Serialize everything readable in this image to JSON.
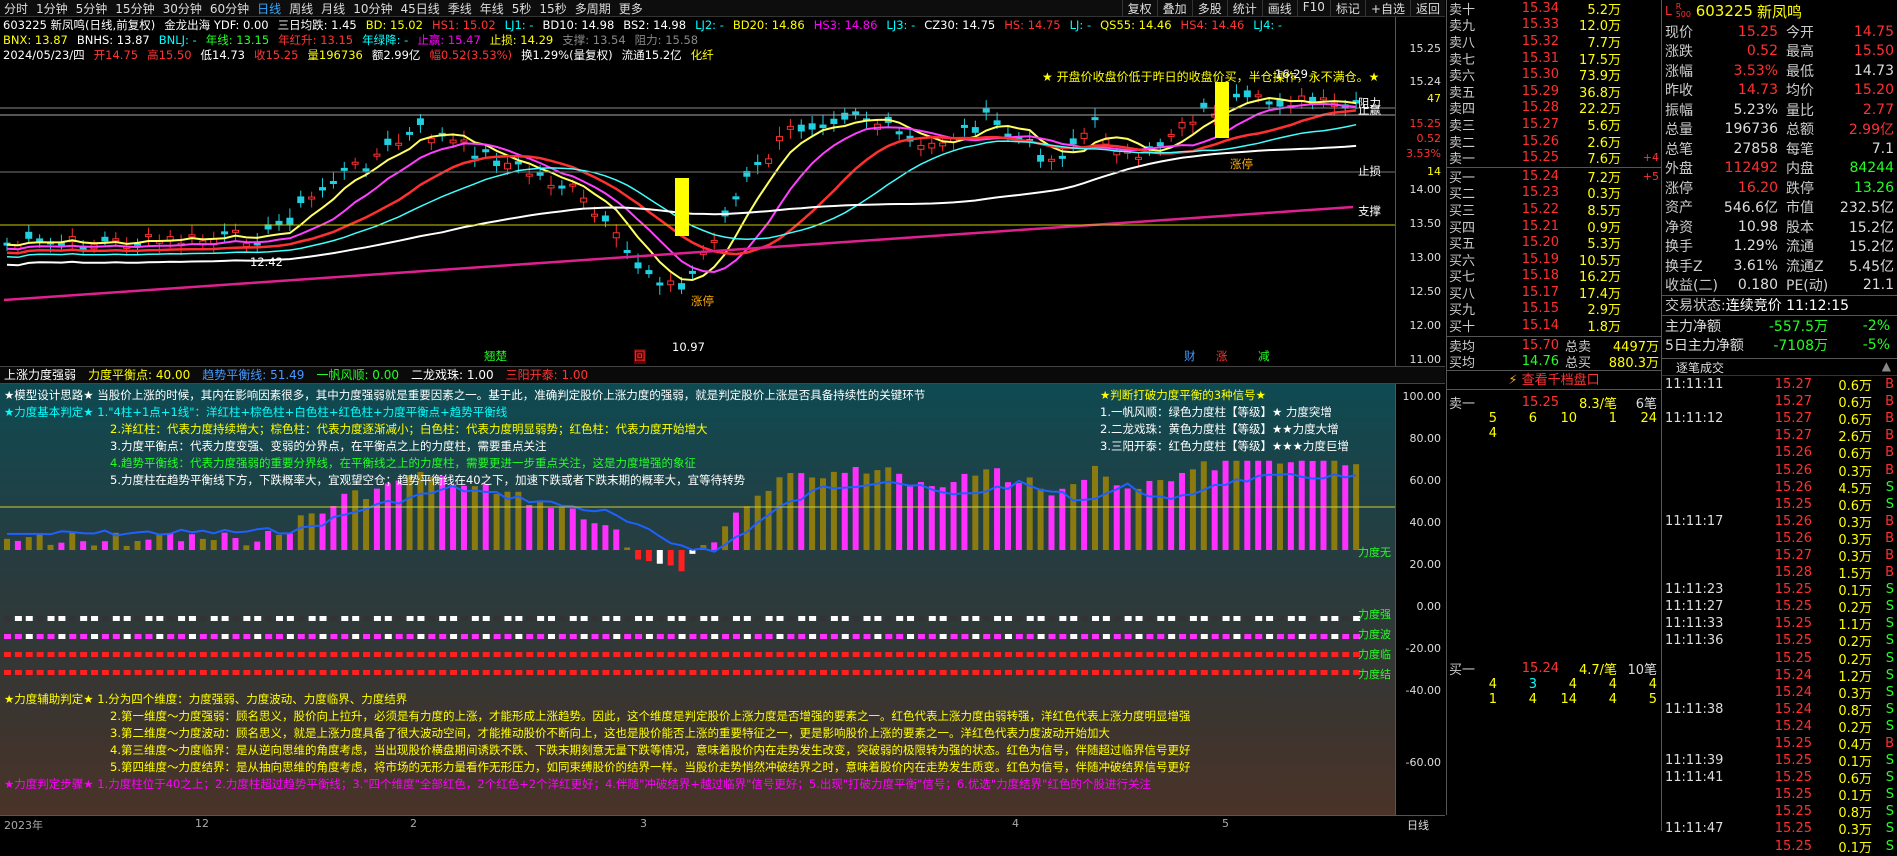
{
  "periods": [
    "分时",
    "1分钟",
    "5分钟",
    "15分钟",
    "30分钟",
    "60分钟",
    "日线",
    "周线",
    "月线",
    "10分钟",
    "45日线",
    "季线",
    "年线",
    "5秒",
    "15秒",
    "多周期",
    "更多"
  ],
  "active_period": "日线",
  "toolbar": [
    "复权",
    "叠加",
    "多股",
    "统计",
    "画线",
    "F10",
    "标记",
    "+自选",
    "返回"
  ],
  "header": {
    "l1": [
      {
        "t": "603225 新凤鸣(日线,前复权)",
        "c": "wht"
      },
      {
        "t": "金龙出海 YDF: 0.00",
        "c": "wht"
      },
      {
        "t": "三日均跌: 1.45",
        "c": "wht"
      },
      {
        "t": "BD: 15.02",
        "c": "yel"
      },
      {
        "t": "HS1: 15.02",
        "c": "red"
      },
      {
        "t": "LJ1: -",
        "c": "cya"
      },
      {
        "t": "BD10: 14.98",
        "c": "wht"
      },
      {
        "t": "BS2: 14.98",
        "c": "wht"
      },
      {
        "t": "LJ2: -",
        "c": "cya"
      },
      {
        "t": "BD20: 14.86",
        "c": "yel"
      },
      {
        "t": "HS3: 14.86",
        "c": "mag"
      },
      {
        "t": "LJ3: -",
        "c": "cya"
      },
      {
        "t": "CZ30: 14.75",
        "c": "wht"
      },
      {
        "t": "HS: 14.75",
        "c": "red"
      },
      {
        "t": "LJ: -",
        "c": "cya"
      },
      {
        "t": "QS55: 14.46",
        "c": "yel"
      },
      {
        "t": "HS4: 14.46",
        "c": "red"
      },
      {
        "t": "LJ4: -",
        "c": "cya"
      }
    ],
    "l2": [
      {
        "t": "BNX: 13.87",
        "c": "yel"
      },
      {
        "t": "BNHS: 13.87",
        "c": "wht"
      },
      {
        "t": "BNLJ: -",
        "c": "cya"
      },
      {
        "t": "年线: 13.15",
        "c": "grn"
      },
      {
        "t": "年红升: 13.15",
        "c": "red"
      },
      {
        "t": "年绿降: -",
        "c": "cya"
      },
      {
        "t": "止赢: 15.47",
        "c": "mag"
      },
      {
        "t": "止损: 14.29",
        "c": "yel"
      },
      {
        "t": "支撑: 13.54",
        "c": "gry"
      },
      {
        "t": "阻力: 15.58",
        "c": "gry"
      }
    ],
    "l3": [
      {
        "t": "2024/05/23/四",
        "c": "wht"
      },
      {
        "t": "开14.75",
        "c": "red"
      },
      {
        "t": "高15.50",
        "c": "red"
      },
      {
        "t": "低14.73",
        "c": "wht"
      },
      {
        "t": "收15.25",
        "c": "red"
      },
      {
        "t": "量196736",
        "c": "yel"
      },
      {
        "t": "额2.99亿",
        "c": "wht"
      },
      {
        "t": "幅0.52(3.53%)",
        "c": "red"
      },
      {
        "t": "换1.29%(量复权)",
        "c": "wht"
      },
      {
        "t": "流通15.2亿",
        "c": "wht"
      },
      {
        "t": "化纤",
        "c": "yel"
      }
    ]
  },
  "chart_labels": {
    "banner": "★ 开盘价收盘价低于昨日的收盘价买，半仓操作，永不满仓。★",
    "high": "16.29",
    "low": "10.97",
    "zhangting": "涨停",
    "zhangting2": "涨停",
    "zs": "止损",
    "zy": "止赢",
    "zl": "阻力",
    "zc": "支撑",
    "price_mark": "15.25",
    "tag_pct": "3.53%",
    "tag_chg": "0.52",
    "tag_14": "14",
    "tag_47": "47",
    "tag_12": "12.42",
    "cai": "财",
    "zhang": "涨",
    "jian": "减",
    "qiao": "翘楚",
    "hui": "回"
  },
  "axis_main": [
    "15.25",
    "15.24",
    "14.00",
    "13.50",
    "13.00",
    "12.50",
    "12.00",
    "11.50",
    "11.00"
  ],
  "sub_header": [
    {
      "t": "上涨力度强弱",
      "c": "wht"
    },
    {
      "t": "力度平衡点: 40.00",
      "c": "yel"
    },
    {
      "t": "趋势平衡线: 51.49",
      "c": "blu"
    },
    {
      "t": "一帆风顺: 0.00",
      "c": "grn"
    },
    {
      "t": "二龙戏珠: 1.00",
      "c": "wht"
    },
    {
      "t": "三阳开泰: 1.00",
      "c": "red"
    }
  ],
  "axis_sub": [
    "100.00",
    "80.00",
    "60.00",
    "40.00",
    "20.00",
    "0.00",
    "-20.00",
    "-40.00",
    "-60.00"
  ],
  "sub_notes": {
    "n1": "★模型设计思路★ 当股价上涨的时候，其内在影响因素很多，其中力度强弱就是重要因素之一。基于此，准确判定股价上涨力度的强弱，就是判定股价上涨是否具备持续性的关键环节",
    "n2": "★力度基本判定★ 1.\"4柱+1点+1线\"：洋红柱+棕色柱+白色柱+红色柱+力度平衡点+趋势平衡线",
    "n3": "2.洋红柱：代表力度持续增大；棕色柱：代表力度逐渐减小；白色柱：代表力度明显弱势；红色柱：代表力度开始增大",
    "n4": "3.力度平衡点：代表力度变强、变弱的分界点，在平衡点之上的力度柱，需要重点关注",
    "n5": "4.趋势平衡线：代表力度强弱的重要分界线，在平衡线之上的力度柱，需要更进一步重点关注，这是力度增强的象征",
    "n6": "5.力度柱在趋势平衡线下方，下跌概率大，宜观望空仓；趋势平衡线在40之下，加速下跌或者下跌末期的概率大，宜等待转势",
    "r1": "★判断打破力度平衡的3种信号★",
    "r2": "1.一帆风顺：绿色力度柱【等级】★  力度突增",
    "r3": "2.二龙戏珠：黄色力度柱【等级】★★力度大增",
    "r4": "3.三阳开泰：红色力度柱【等级】★★★力度巨增",
    "b1": "★力度辅助判定★ 1.分为四个维度：力度强弱、力度波动、力度临界、力度结界",
    "b2": "2.第一维度～力度强弱：顾名思义，股价向上拉升，必须是有力度的上涨，才能形成上涨趋势。因此，这个维度是判定股价上涨力度是否增强的要素之一。红色代表上涨力度由弱转强，洋红色代表上涨力度明显增强",
    "b3": "3.第二维度～力度波动：顾名思义，就是上涨力度具备了很大波动空间，才能推动股价不断向上，这也是股价能否上涨的重要特征之一，更是影响股价上涨的要素之一。洋红色代表力度波动开始加大",
    "b4": "4.第三维度～力度临界：是从逆向思维的角度考虑，当出现股价横盘期间诱跌不跌、下跌末期刻意无量下跌等情况，意味着股价内在走势发生改变，突破弱的极限转为强的状态。红色为信号，伴随超过临界信号更好",
    "b5": "5.第四维度～力度结界：是从抽向思维的角度考虑，将市场的无形力量看作无形压力，如同束缚股价的结界一样。当股价走势悄然冲破结界之时，意味着股价内在走势发生质变。红色为信号，伴随冲破结界信号更好",
    "b6": "★力度判定步骤★ 1.力度柱位于40之上；2.力度柱超过趋势平衡线；3.\"四个维度\"全部红色，2个红色+2个洋红更好；4.伴随\"冲破结界+越过临界\"信号更好；5.出现\"打破力度平衡\"信号；6.优选\"力度结界\"红色的个股进行关注",
    "side1": "力度无",
    "side2": "力度强",
    "side3": "力度波",
    "side4": "力度临",
    "side5": "力度结"
  },
  "dates": [
    "2023年",
    "12",
    "2",
    "3",
    "4",
    "5",
    "日线"
  ],
  "orderbook": {
    "asks": [
      [
        "卖十",
        "15.34",
        "5.2万",
        ""
      ],
      [
        "卖九",
        "15.33",
        "12.0万",
        ""
      ],
      [
        "卖八",
        "15.32",
        "7.7万",
        ""
      ],
      [
        "卖七",
        "15.31",
        "17.5万",
        ""
      ],
      [
        "卖六",
        "15.30",
        "73.9万",
        ""
      ],
      [
        "卖五",
        "15.29",
        "36.8万",
        ""
      ],
      [
        "卖四",
        "15.28",
        "22.2万",
        ""
      ],
      [
        "卖三",
        "15.27",
        "5.6万",
        ""
      ],
      [
        "卖二",
        "15.26",
        "2.6万",
        ""
      ],
      [
        "卖一",
        "15.25",
        "7.6万",
        "+4"
      ]
    ],
    "bids": [
      [
        "买一",
        "15.24",
        "7.2万",
        "+5"
      ],
      [
        "买二",
        "15.23",
        "0.3万",
        ""
      ],
      [
        "买三",
        "15.22",
        "8.5万",
        ""
      ],
      [
        "买四",
        "15.21",
        "0.9万",
        ""
      ],
      [
        "买五",
        "15.20",
        "5.3万",
        ""
      ],
      [
        "买六",
        "15.19",
        "10.5万",
        ""
      ],
      [
        "买七",
        "15.18",
        "16.2万",
        ""
      ],
      [
        "买八",
        "15.17",
        "17.4万",
        ""
      ],
      [
        "买九",
        "15.15",
        "2.9万",
        ""
      ],
      [
        "买十",
        "15.14",
        "1.8万",
        ""
      ]
    ],
    "avg_ask_label": "卖均",
    "avg_ask": "15.70",
    "total_ask_label": "总卖",
    "total_ask": "4497万",
    "avg_bid_label": "买均",
    "avg_bid": "14.76",
    "total_bid_label": "总买",
    "total_bid": "880.3万",
    "more": "查看千档盘口",
    "q1_label": "卖一",
    "q1_price": "15.25",
    "q1_info": "8.3/笔",
    "q1_count": "6笔",
    "q1_nums": [
      "5",
      "6",
      "10",
      "1",
      "24",
      "4"
    ],
    "q2_label": "买一",
    "q2_price": "15.24",
    "q2_info": "4.7/笔",
    "q2_count": "10笔",
    "q2_nums": [
      "4",
      "3",
      "4",
      "4",
      "4",
      "1",
      "4",
      "14",
      "4",
      "5"
    ]
  },
  "stock": {
    "code": "603225",
    "name": "新凤鸣",
    "flag": "L",
    "badge": "R 500"
  },
  "info": [
    [
      "现价",
      "15.25",
      "今开",
      "14.75"
    ],
    [
      "涨跌",
      "0.52",
      "最高",
      "15.50"
    ],
    [
      "涨幅",
      "3.53%",
      "最低",
      "14.73"
    ],
    [
      "昨收",
      "14.73",
      "均价",
      "15.20"
    ],
    [
      "振幅",
      "5.23%",
      "量比",
      "2.77"
    ],
    [
      "总量",
      "196736",
      "总额",
      "2.99亿"
    ],
    [
      "总笔",
      "27858",
      "每笔",
      "7.1"
    ],
    [
      "外盘",
      "112492",
      "内盘",
      "84244"
    ],
    [
      "涨停",
      "16.20",
      "跌停",
      "13.26"
    ],
    [
      "资产",
      "546.6亿",
      "市值",
      "232.5亿"
    ],
    [
      "净资",
      "10.98",
      "股本",
      "15.2亿"
    ],
    [
      "换手",
      "1.29%",
      "流通",
      "15.2亿"
    ],
    [
      "换手Z",
      "3.61%",
      "流通Z",
      "5.45亿"
    ],
    [
      "收益(二)",
      "0.180",
      "PE(动)",
      "21.1"
    ]
  ],
  "status": {
    "label": "交易状态:",
    "value": "连续竞价 11:12:15"
  },
  "netflow": [
    {
      "k": "主力净额",
      "v": "-557.5万",
      "p": "-2%"
    },
    {
      "k": "5日主力净额",
      "v": "-7108万",
      "p": "-5%"
    }
  ],
  "trades_title": "逐笔成交",
  "trades": [
    [
      "11:11:11",
      "15.27",
      "0.6万",
      "B"
    ],
    [
      "",
      "15.27",
      "0.6万",
      "B"
    ],
    [
      "11:11:12",
      "15.27",
      "0.6万",
      "B"
    ],
    [
      "",
      "15.27",
      "2.6万",
      "B"
    ],
    [
      "",
      "15.26",
      "0.6万",
      "B"
    ],
    [
      "",
      "15.26",
      "0.3万",
      "B"
    ],
    [
      "",
      "15.26",
      "4.5万",
      "S"
    ],
    [
      "",
      "15.25",
      "0.6万",
      "S"
    ],
    [
      "11:11:17",
      "15.26",
      "0.3万",
      "B"
    ],
    [
      "",
      "15.26",
      "0.3万",
      "B"
    ],
    [
      "",
      "15.27",
      "0.3万",
      "B"
    ],
    [
      "",
      "15.28",
      "1.5万",
      "B"
    ],
    [
      "11:11:23",
      "15.25",
      "0.1万",
      "S"
    ],
    [
      "11:11:27",
      "15.25",
      "0.2万",
      "S"
    ],
    [
      "11:11:33",
      "15.25",
      "1.1万",
      "S"
    ],
    [
      "11:11:36",
      "15.25",
      "0.2万",
      "S"
    ],
    [
      "",
      "15.25",
      "0.2万",
      "S"
    ],
    [
      "",
      "15.24",
      "1.2万",
      "S"
    ],
    [
      "",
      "15.24",
      "0.3万",
      "S"
    ],
    [
      "11:11:38",
      "15.24",
      "0.8万",
      "S"
    ],
    [
      "",
      "15.24",
      "0.2万",
      "S"
    ],
    [
      "",
      "15.25",
      "0.4万",
      "B"
    ],
    [
      "11:11:39",
      "15.25",
      "0.1万",
      "S"
    ],
    [
      "11:11:41",
      "15.25",
      "0.6万",
      "S"
    ],
    [
      "",
      "15.25",
      "0.1万",
      "S"
    ],
    [
      "",
      "15.25",
      "0.8万",
      "S"
    ],
    [
      "11:11:47",
      "15.25",
      "0.3万",
      "S"
    ],
    [
      "",
      "15.25",
      "0.1万",
      "S"
    ]
  ],
  "colors": {
    "up": "#ff3030",
    "down": "#20d0e0",
    "bg": "#000000",
    "accent": "#ffff00",
    "mag": "#ff30ff"
  }
}
